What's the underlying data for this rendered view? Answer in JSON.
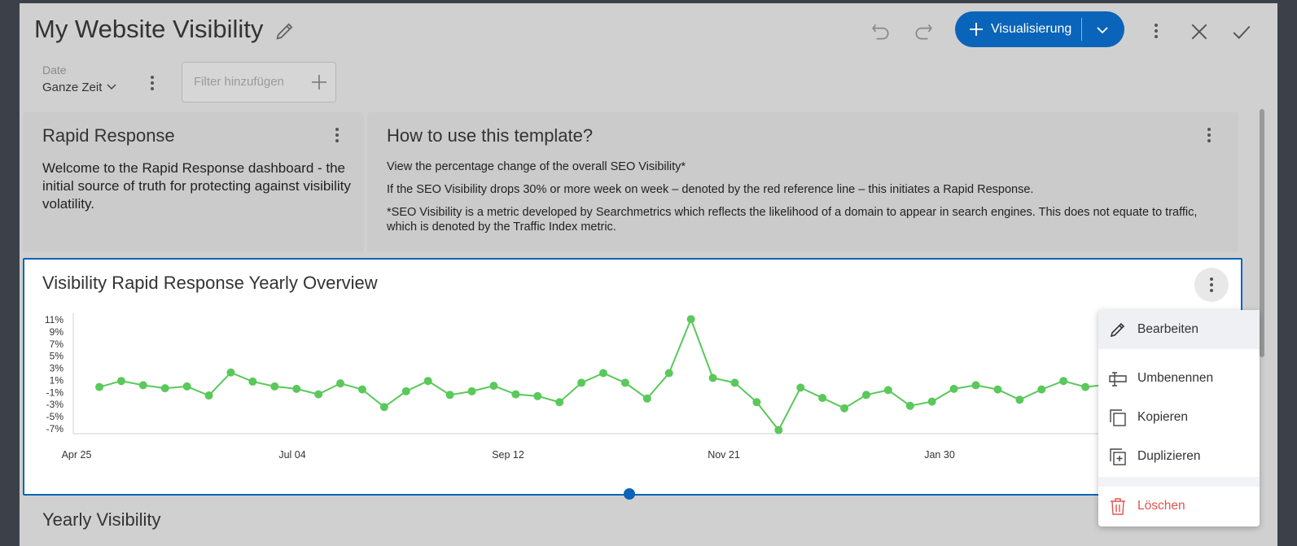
{
  "header": {
    "title": "My Website Visibility",
    "add_visualization_label": "Visualisierung"
  },
  "filters": {
    "date_label": "Date",
    "date_value": "Ganze Zeit",
    "add_filter_placeholder": "Filter hinzufügen"
  },
  "cards": {
    "rapid_response": {
      "title": "Rapid Response",
      "text": "Welcome to the Rapid Response dashboard - the initial source of truth for protecting against visibility volatility."
    },
    "how_to": {
      "title": "How to use this template?",
      "lines": [
        "View the percentage change of the overall SEO Visibility*",
        "If the SEO Visibility drops 30% or more week on week – denoted by the red reference line – this initiates a Rapid Response.",
        "*SEO Visibility is a metric developed by Searchmetrics which reflects the likelihood of a domain to appear in search engines. This does not equate to traffic, which is denoted by the Traffic Index metric."
      ]
    },
    "chart": {
      "title": "Visibility Rapid Response Yearly Overview"
    },
    "yearly": {
      "title": "Yearly Visibility"
    }
  },
  "context_menu": {
    "items": [
      {
        "label": "Bearbeiten",
        "icon": "pencil-icon"
      },
      {
        "label": "Umbenennen",
        "icon": "rename-icon"
      },
      {
        "label": "Kopieren",
        "icon": "copy-icon"
      },
      {
        "label": "Duplizieren",
        "icon": "duplicate-icon"
      },
      {
        "label": "Löschen",
        "icon": "trash-icon"
      }
    ]
  },
  "colors": {
    "accent": "#0a64b9",
    "series": "#5ac85a",
    "danger": "#e2534e"
  },
  "chart_data": {
    "type": "line",
    "title": "Visibility Rapid Response Yearly Overview",
    "y_ticks": [
      "11%",
      "9%",
      "7%",
      "5%",
      "3%",
      "1%",
      "-1%",
      "-3%",
      "-5%",
      "-7%"
    ],
    "ylim": [
      -7,
      11
    ],
    "x_ticks": [
      "Apr 25",
      "Jul 04",
      "Sep 12",
      "Nov 21",
      "Jan 30"
    ],
    "series": [
      {
        "values": [
          -0.1,
          0.9,
          0.2,
          -0.3,
          0.0,
          -1.5,
          2.3,
          0.8,
          0.0,
          -0.4,
          -1.3,
          0.5,
          -0.5,
          -3.4,
          -0.8,
          0.9,
          -1.4,
          -0.8,
          0.1,
          -1.3,
          -1.6,
          -2.6,
          0.6,
          2.2,
          0.6,
          -2.0,
          2.2,
          11.1,
          1.4,
          0.6,
          -2.6,
          -7.2,
          -0.2,
          -1.9,
          -3.6,
          -1.4,
          -0.6,
          -3.2,
          -2.5,
          -0.4,
          0.2,
          -0.5,
          -2.2,
          -0.5,
          0.9,
          -0.1,
          0.3
        ]
      }
    ]
  }
}
